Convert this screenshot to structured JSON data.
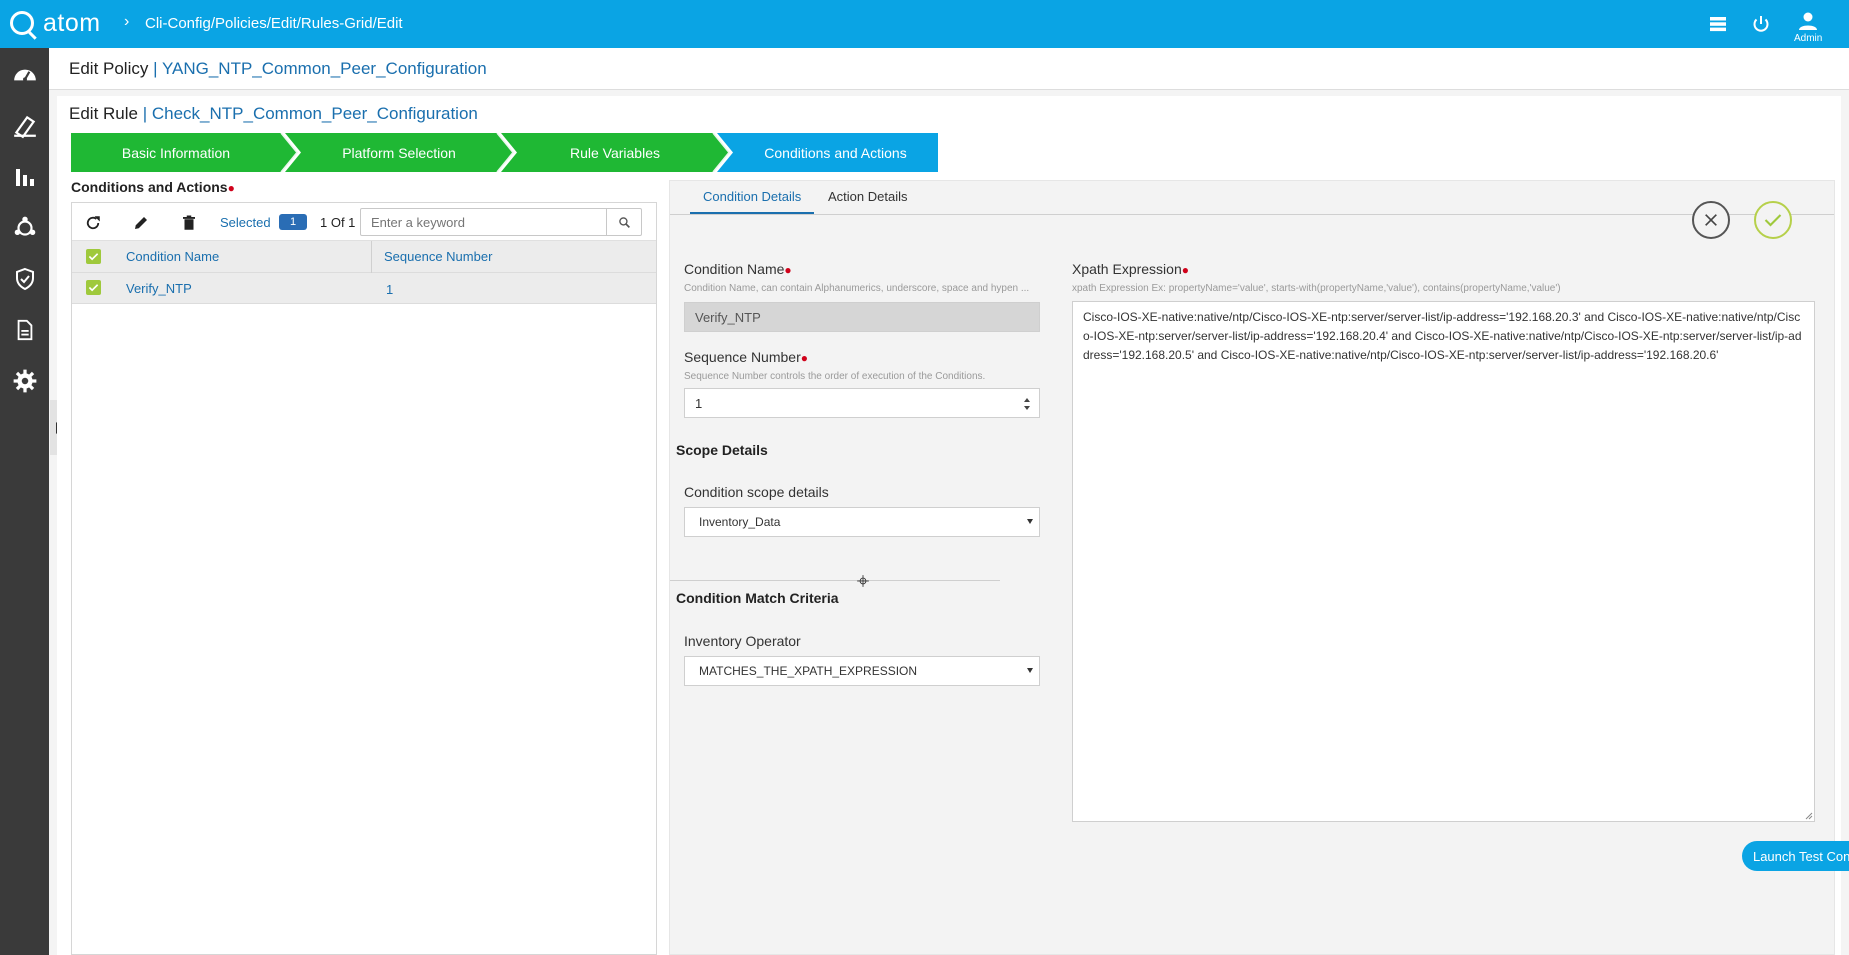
{
  "header": {
    "logo_text": "atom",
    "breadcrumb": "Cli-Config/Policies/Edit/Rules-Grid/Edit",
    "user_label": "Admin"
  },
  "sidebar": {
    "items": [
      {
        "icon": "dashboard-icon"
      },
      {
        "icon": "devices-icon"
      },
      {
        "icon": "analytics-icon"
      },
      {
        "icon": "topology-icon"
      },
      {
        "icon": "compliance-shield-icon"
      },
      {
        "icon": "document-icon"
      },
      {
        "icon": "settings-gear-icon"
      }
    ]
  },
  "page": {
    "policy_prefix": "Edit Policy",
    "policy_separator": " | ",
    "policy_name": "YANG_NTP_Common_Peer_Configuration",
    "rule_prefix": "Edit Rule",
    "rule_separator": " | ",
    "rule_name": "Check_NTP_Common_Peer_Configuration"
  },
  "steps": [
    {
      "label": "Basic Information",
      "state": "done"
    },
    {
      "label": "Platform Selection",
      "state": "done"
    },
    {
      "label": "Rule Variables",
      "state": "done"
    },
    {
      "label": "Conditions and Actions",
      "state": "active"
    }
  ],
  "conditions_grid": {
    "section_label": "Conditions and Actions",
    "selected_label": "Selected",
    "selected_count": "1",
    "page_count": "1 Of 1",
    "search_placeholder": "Enter a keyword",
    "columns": [
      "Condition Name",
      "Sequence Number"
    ],
    "rows": [
      {
        "name": "Verify_NTP",
        "sequence": "1",
        "checked": true
      }
    ]
  },
  "detail_panel": {
    "tabs": [
      "Condition Details",
      "Action Details"
    ],
    "active_tab": "Condition Details",
    "condition_name": {
      "label": "Condition Name",
      "hint": "Condition Name, can contain Alphanumerics, underscore, space and hypen ...",
      "value": "Verify_NTP"
    },
    "sequence_number": {
      "label": "Sequence Number",
      "hint": "Sequence Number controls the order of execution of the Conditions.",
      "value": "1"
    },
    "scope": {
      "section_title": "Scope Details",
      "label": "Condition scope details",
      "value": "Inventory_Data"
    },
    "match": {
      "section_title": "Condition Match Criteria",
      "label": "Inventory Operator",
      "value": "MATCHES_THE_XPATH_EXPRESSION"
    },
    "xpath": {
      "label": "Xpath Expression",
      "hint": "xpath Expression Ex: propertyName='value', starts-with(propertyName,'value'), contains(propertyName,'value')",
      "value": "Cisco-IOS-XE-native:native/ntp/Cisco-IOS-XE-ntp:server/server-list/ip-address='192.168.20.3' and Cisco-IOS-XE-native:native/ntp/Cisco-IOS-XE-ntp:server/server-list/ip-address='192.168.20.4' and Cisco-IOS-XE-native:native/ntp/Cisco-IOS-XE-ntp:server/server-list/ip-address='192.168.20.5' and Cisco-IOS-XE-native:native/ntp/Cisco-IOS-XE-ntp:server/server-list/ip-address='192.168.20.6'"
    },
    "launch_button": "Launch Test Config"
  },
  "colors": {
    "topbar": "#0aa4e4",
    "step_done": "#1fb834",
    "step_active": "#0aa4e4",
    "link_blue": "#1a6fae",
    "required_dot": "#d0021b",
    "checkbox_green": "#9fc93c"
  }
}
